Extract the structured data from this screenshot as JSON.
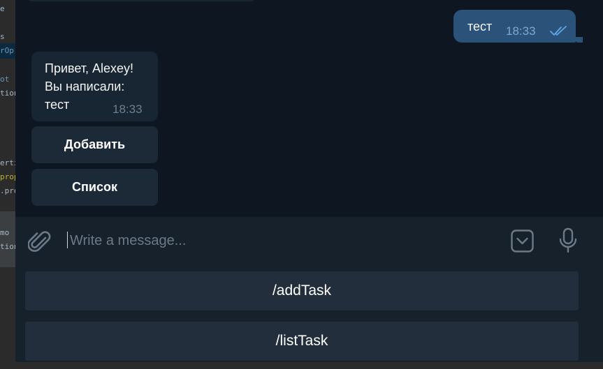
{
  "background_ide": {
    "lines": [
      "e",
      "s",
      "rOp",
      "ot",
      "tion",
      "ertie",
      "prop",
      ".pro",
      "mo",
      "tion"
    ]
  },
  "chat": {
    "outgoing": {
      "text": "тест",
      "time": "18:33",
      "status": "read"
    },
    "incoming": {
      "lines": [
        "Привет, Alexey!",
        "Вы написали:",
        "тест"
      ],
      "time": "18:33"
    },
    "inline_buttons": [
      "Добавить",
      "Список"
    ]
  },
  "composer": {
    "placeholder": "Write a message..."
  },
  "reply_keyboard": {
    "buttons": [
      "/addTask",
      "/listTask"
    ]
  },
  "colors": {
    "chat_bg": "#0e1621",
    "outgoing_bubble": "#2b5278",
    "incoming_bubble": "#182533",
    "panel": "#17212b",
    "keyboard_button": "#232e3c"
  }
}
